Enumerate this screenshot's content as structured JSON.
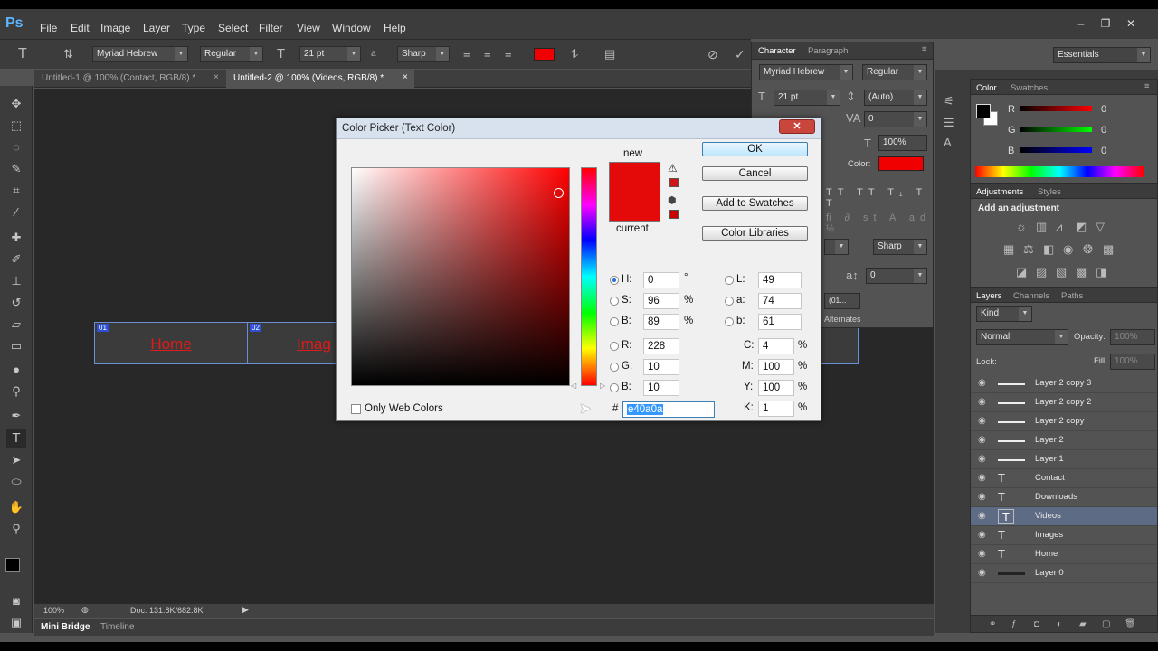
{
  "app": {
    "logo": "Ps"
  },
  "menu": [
    "File",
    "Edit",
    "Image",
    "Layer",
    "Type",
    "Select",
    "Filter",
    "View",
    "Window",
    "Help"
  ],
  "window_controls": {
    "minimize": "–",
    "restore": "❐",
    "close": "✕"
  },
  "options_bar": {
    "font_family": "Myriad Hebrew",
    "font_style": "Regular",
    "font_size": "21 pt",
    "aa_label": "a",
    "anti_alias": "Sharp",
    "text_color": "#f00000",
    "workspace": "Essentials"
  },
  "doc_tabs": [
    {
      "label": "Untitled-1 @ 100% (Contact, RGB/8) *",
      "close": "×"
    },
    {
      "label": "Untitled-2 @ 100% (Videos, RGB/8) *",
      "close": "×"
    }
  ],
  "canvas": {
    "nav_items": [
      {
        "slice": "01",
        "label": "Home"
      },
      {
        "slice": "02",
        "label": "Imag"
      }
    ],
    "text_color": "#e01a1a"
  },
  "status_bar": {
    "zoom": "100%",
    "doc": "Doc: 131.8K/682.8K"
  },
  "bottom_tabs": [
    "Mini Bridge",
    "Timeline"
  ],
  "character_panel": {
    "tabs": [
      "Character",
      "Paragraph"
    ],
    "font_family": "Myriad Hebrew",
    "font_style": "Regular",
    "size": "21 pt",
    "leading": "(Auto)",
    "tracking": "0",
    "scale": "100%",
    "color_label": "Color:",
    "aa": "Sharp",
    "baseline": "0",
    "lang_hint": "(01...",
    "alternates": "Alternates"
  },
  "color_panel": {
    "tabs": [
      "Color",
      "Swatches"
    ],
    "channels": [
      {
        "name": "R",
        "value": "0"
      },
      {
        "name": "G",
        "value": "0"
      },
      {
        "name": "B",
        "value": "0"
      }
    ]
  },
  "adjustments_panel": {
    "tabs": [
      "Adjustments",
      "Styles"
    ],
    "title": "Add an adjustment"
  },
  "layers_panel": {
    "tabs": [
      "Layers",
      "Channels",
      "Paths"
    ],
    "filter": "Kind",
    "blend_mode": "Normal",
    "opacity_label": "Opacity:",
    "opacity": "100%",
    "lock_label": "Lock:",
    "fill_label": "Fill:",
    "fill": "100%",
    "layers": [
      {
        "name": "Layer 2 copy 3",
        "type": "line"
      },
      {
        "name": "Layer 2 copy 2",
        "type": "line"
      },
      {
        "name": "Layer 2 copy",
        "type": "line"
      },
      {
        "name": "Layer 2",
        "type": "line"
      },
      {
        "name": "Layer 1",
        "type": "line"
      },
      {
        "name": "Contact",
        "type": "text"
      },
      {
        "name": "Downloads",
        "type": "text"
      },
      {
        "name": "Videos",
        "type": "text",
        "selected": true
      },
      {
        "name": "Images",
        "type": "text"
      },
      {
        "name": "Home",
        "type": "text"
      },
      {
        "name": "Layer 0",
        "type": "fill"
      }
    ]
  },
  "color_picker": {
    "title": "Color Picker (Text Color)",
    "close": "✕",
    "new_label": "new",
    "current_label": "current",
    "new_color": "#e40a0a",
    "current_color": "#e40a0a",
    "buttons": {
      "ok": "OK",
      "cancel": "Cancel",
      "add_swatches": "Add to Swatches",
      "libraries": "Color Libraries"
    },
    "hsb": [
      {
        "label": "H:",
        "value": "0",
        "unit": "°",
        "selected": true
      },
      {
        "label": "S:",
        "value": "96",
        "unit": "%"
      },
      {
        "label": "B:",
        "value": "89",
        "unit": "%"
      }
    ],
    "rgb": [
      {
        "label": "R:",
        "value": "228"
      },
      {
        "label": "G:",
        "value": "10"
      },
      {
        "label": "B:",
        "value": "10"
      }
    ],
    "lab": [
      {
        "label": "L:",
        "value": "49"
      },
      {
        "label": "a:",
        "value": "74"
      },
      {
        "label": "b:",
        "value": "61"
      }
    ],
    "cmyk": [
      {
        "label": "C:",
        "value": "4",
        "unit": "%"
      },
      {
        "label": "M:",
        "value": "100",
        "unit": "%"
      },
      {
        "label": "Y:",
        "value": "100",
        "unit": "%"
      },
      {
        "label": "K:",
        "value": "1",
        "unit": "%"
      }
    ],
    "hex_label": "#",
    "hex_value": "e40a0a",
    "web_only_label": "Only Web Colors"
  }
}
